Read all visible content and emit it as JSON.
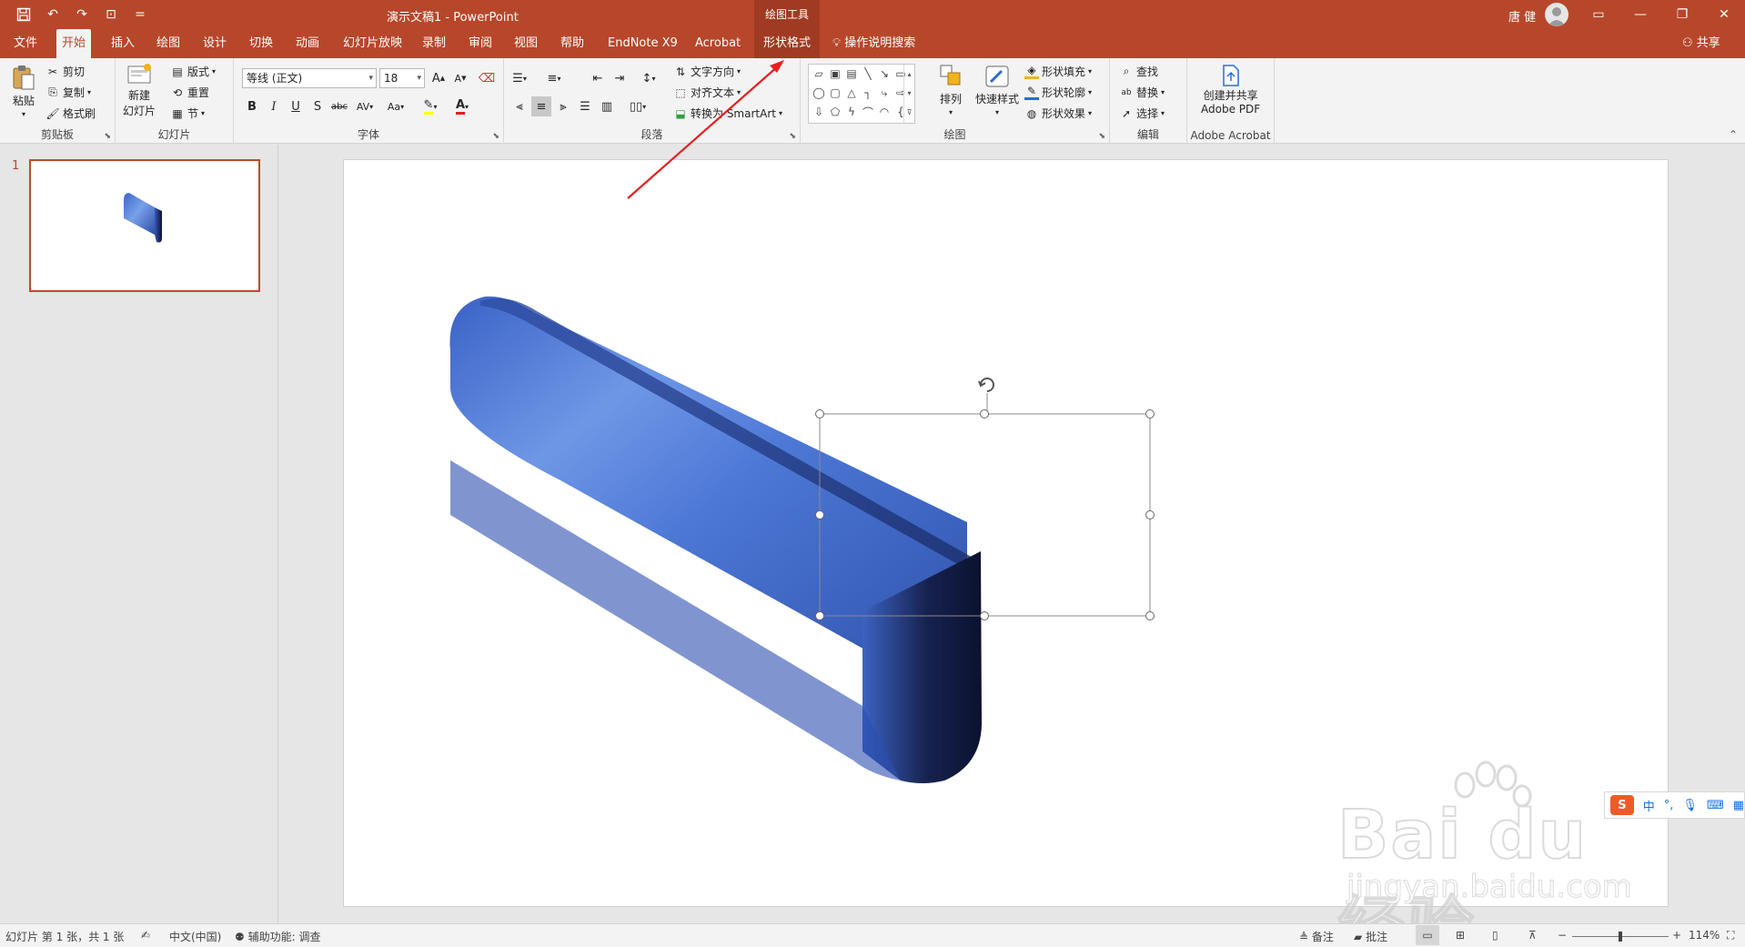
{
  "titlebar": {
    "doc_title": "演示文稿1  -  PowerPoint",
    "tool_context": "绘图工具",
    "user": "唐 健",
    "qat_customize": "="
  },
  "tabs": [
    {
      "label": "文件"
    },
    {
      "label": "开始"
    },
    {
      "label": "插入"
    },
    {
      "label": "绘图"
    },
    {
      "label": "设计"
    },
    {
      "label": "切换"
    },
    {
      "label": "动画"
    },
    {
      "label": "幻灯片放映"
    },
    {
      "label": "录制"
    },
    {
      "label": "审阅"
    },
    {
      "label": "视图"
    },
    {
      "label": "帮助"
    },
    {
      "label": "EndNote X9"
    },
    {
      "label": "Acrobat"
    },
    {
      "label": "形状格式"
    }
  ],
  "tell_me": "操作说明搜索",
  "share": "共享",
  "ribbon": {
    "clipboard": {
      "label": "剪贴板",
      "paste": "粘贴",
      "cut": "剪切",
      "copy": "复制",
      "format_painter": "格式刷"
    },
    "slides": {
      "label": "幻灯片",
      "new_slide_1": "新建",
      "new_slide_2": "幻灯片",
      "layout": "版式",
      "reset": "重置",
      "section": "节"
    },
    "font": {
      "label": "字体",
      "font_name": "等线 (正文)",
      "font_size": "18",
      "bold": "B",
      "italic": "I",
      "underline": "U",
      "strike": "S",
      "abc": "abc",
      "spacing": "AV",
      "case": "Aa",
      "grow": "A",
      "shrink": "A",
      "color_a": "A"
    },
    "paragraph": {
      "label": "段落",
      "text_direction": "文字方向",
      "align_text": "对齐文本",
      "smartart": "转换为 SmartArt"
    },
    "drawing": {
      "label": "绘图",
      "arrange": "排列",
      "quick_styles": "快速样式",
      "fill": "形状填充",
      "outline": "形状轮廓",
      "effects": "形状效果"
    },
    "editing": {
      "label": "编辑",
      "find": "查找",
      "replace": "替换",
      "select": "选择"
    },
    "acrobat": {
      "label": "Adobe Acrobat",
      "create_1": "创建并共享",
      "create_2": "Adobe PDF"
    }
  },
  "thumbnail": {
    "number": "1"
  },
  "watermark": {
    "logo": "Bai du 经验",
    "url": "jingyan.baidu.com"
  },
  "ime": {
    "mode": "中",
    "punct": "°,"
  },
  "statusbar": {
    "slide_info": "幻灯片 第 1 张，共 1 张",
    "language": "中文(中国)",
    "accessibility": "辅助功能: 调查",
    "notes": "备注",
    "comments": "批注",
    "zoom_minus": "−",
    "zoom_plus": "+",
    "zoom": "114%",
    "zoom_level": 0.5
  },
  "colors": {
    "accent": "#b7472a",
    "shape_light": "#5b86e0",
    "shape_dark": "#0b1230"
  }
}
